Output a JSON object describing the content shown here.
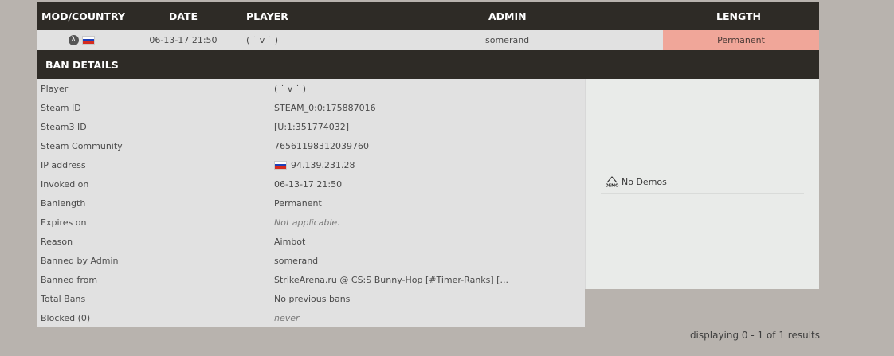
{
  "table": {
    "headers": {
      "mod": "MOD/COUNTRY",
      "date": "DATE",
      "player": "PLAYER",
      "admin": "ADMIN",
      "length": "LENGTH"
    },
    "row": {
      "mod_icon": "half-life-icon",
      "country_flag": "russia-flag-icon",
      "date": "06-13-17 21:50",
      "player": "( ˙ v ˙ )",
      "admin": "somerand",
      "length": "Permanent",
      "length_color": "#f0a699"
    }
  },
  "ban_details": {
    "title": "BAN DETAILS",
    "rows": [
      {
        "label": "Player",
        "value": "( ˙ v ˙ )"
      },
      {
        "label": "Steam ID",
        "value": "STEAM_0:0:175887016"
      },
      {
        "label": "Steam3 ID",
        "value": "[U:1:351774032]"
      },
      {
        "label": "Steam Community",
        "value": "76561198312039760"
      },
      {
        "label": "IP address",
        "value": "94.139.231.28"
      },
      {
        "label": "Invoked on",
        "value": "06-13-17 21:50"
      },
      {
        "label": "Banlength",
        "value": "Permanent"
      },
      {
        "label": "Expires on",
        "value": "Not applicable."
      },
      {
        "label": "Reason",
        "value": "Aimbot"
      },
      {
        "label": "Banned by Admin",
        "value": "somerand"
      },
      {
        "label": "Banned from",
        "value": "StrikeArena.ru @ CS:S Bunny-Hop [#Timer-Ranks] [..."
      },
      {
        "label": "Total Bans",
        "value": "No previous bans"
      },
      {
        "label": "Blocked (0)",
        "value": "never"
      }
    ],
    "demos": {
      "icon": "demo-icon",
      "label": "No Demos"
    }
  },
  "footer": {
    "text": "displaying 0 - 1 of 1 results"
  }
}
